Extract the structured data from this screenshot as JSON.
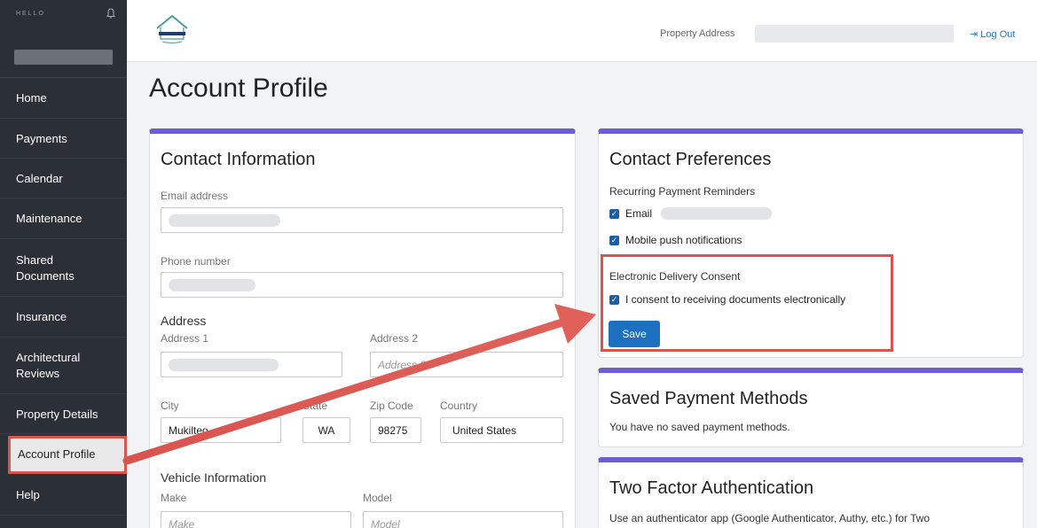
{
  "sidebar": {
    "greeting": "HELLO",
    "items": [
      {
        "label": "Home"
      },
      {
        "label": "Payments"
      },
      {
        "label": "Calendar"
      },
      {
        "label": "Maintenance"
      },
      {
        "label": "Shared Documents"
      },
      {
        "label": "Insurance"
      },
      {
        "label": "Architectural Reviews"
      },
      {
        "label": "Property Details"
      },
      {
        "label": "Account Profile"
      },
      {
        "label": "Help"
      }
    ],
    "active": "Account Profile"
  },
  "topbar": {
    "property_label": "Property Address",
    "logout_label": "Log Out"
  },
  "page_title": "Account Profile",
  "contact_info": {
    "title": "Contact Information",
    "email_label": "Email address",
    "phone_label": "Phone number",
    "address_heading": "Address",
    "address1_label": "Address 1",
    "address2_label": "Address 2",
    "address2_placeholder": "Address 2",
    "city_label": "City",
    "city_value": "Mukilteo",
    "state_label": "State",
    "state_value": "WA",
    "zip_label": "Zip Code",
    "zip_value": "98275",
    "country_label": "Country",
    "country_value": "United States",
    "vehicle_heading": "Vehicle Information",
    "make_label": "Make",
    "make_placeholder": "Make",
    "model_label": "Model",
    "model_placeholder": "Model"
  },
  "contact_prefs": {
    "title": "Contact Preferences",
    "recurring_label": "Recurring Payment Reminders",
    "email_option": "Email",
    "push_option": "Mobile push notifications",
    "consent_heading": "Electronic Delivery Consent",
    "consent_option": "I consent to receiving documents electronically",
    "save_label": "Save"
  },
  "saved_payment": {
    "title": "Saved Payment Methods",
    "text": "You have no saved payment methods."
  },
  "two_factor": {
    "title": "Two Factor Authentication",
    "text": "Use an authenticator app (Google Authenticator, Authy, etc.) for Two"
  },
  "colors": {
    "sidebar_bg": "#2b2f36",
    "accent": "#6f5ed3",
    "primary": "#1d6fc0",
    "highlight": "#d9534f"
  }
}
